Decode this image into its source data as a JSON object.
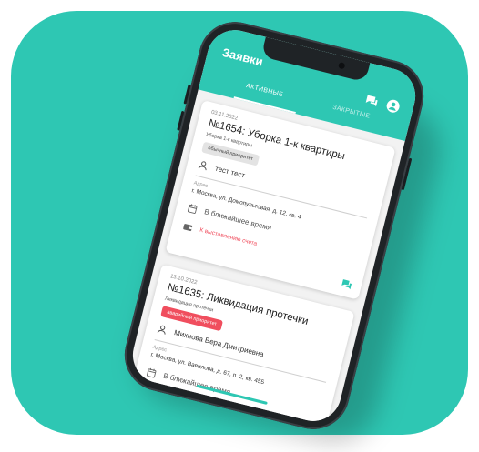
{
  "app": {
    "title": "Заявки",
    "accent_color": "#2ec7b3",
    "icons": [
      "chat-icon",
      "profile-icon"
    ]
  },
  "tabs": [
    {
      "label": "АКТИВНЫЕ",
      "active": true
    },
    {
      "label": "ЗАКРЫТЫЕ",
      "active": false
    }
  ],
  "orders": [
    {
      "date": "03.11.2022",
      "title": "№1654: Уборка 1-к квартиры",
      "subtitle": "Уборка 1-к квартиры",
      "priority": "обычный приоритет",
      "priority_color": "#e3e3e3",
      "person": "тест тест",
      "address_label": "Адрес",
      "address": "г. Москва, ул. Домопультовая, д. 12, кв. 4",
      "time": "В ближайшее время",
      "status": "К выставлению счета",
      "status_color": "#f04e5e"
    },
    {
      "date": "13.10.2022",
      "title": "№1635: Ликвидация протечки",
      "subtitle": "Ликвидация протечки",
      "priority": "аварийный приоритет",
      "priority_color": "#f04e5e",
      "person": "Михнова Вера Дмитриевна",
      "address_label": "Адрес",
      "address": "г. Москва, ул. Вавилова, д. 67, п. 2, кв. 455",
      "time": "В ближайшее время"
    }
  ]
}
